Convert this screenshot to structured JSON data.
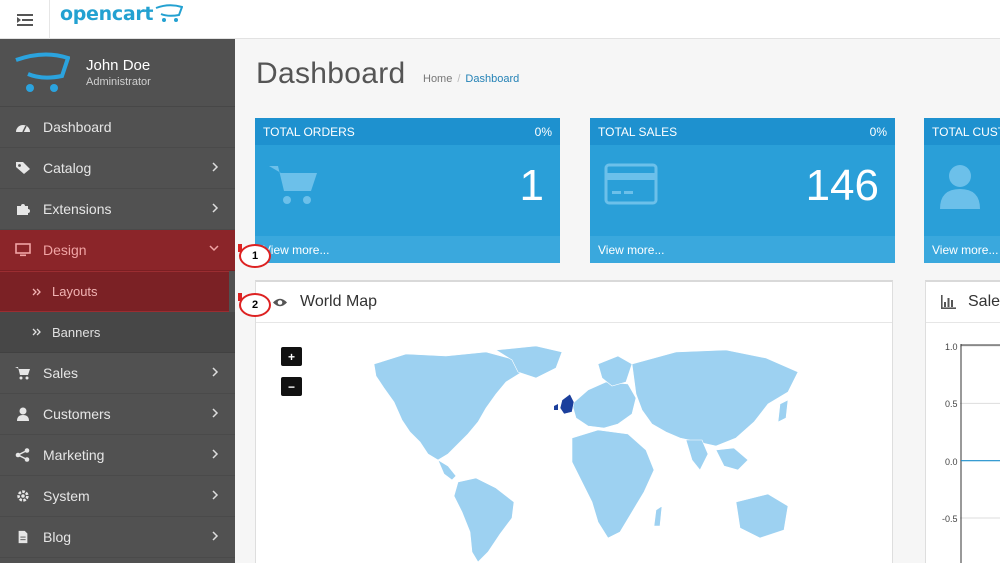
{
  "header": {
    "logo_text": "opencart"
  },
  "sidebar": {
    "profile": {
      "name": "John Doe",
      "role": "Administrator"
    },
    "items": [
      {
        "label": "Dashboard",
        "icon": "dashboard-icon"
      },
      {
        "label": "Catalog",
        "icon": "tags-icon"
      },
      {
        "label": "Extensions",
        "icon": "puzzle-icon"
      },
      {
        "label": "Design",
        "icon": "monitor-icon"
      },
      {
        "label": "Sales",
        "icon": "cart-icon"
      },
      {
        "label": "Customers",
        "icon": "user-icon"
      },
      {
        "label": "Marketing",
        "icon": "share-icon"
      },
      {
        "label": "System",
        "icon": "gear-icon"
      },
      {
        "label": "Blog",
        "icon": "document-icon"
      }
    ],
    "design_sub": [
      {
        "label": "Layouts"
      },
      {
        "label": "Banners"
      }
    ]
  },
  "page": {
    "title": "Dashboard",
    "breadcrumb": {
      "home": "Home",
      "separator": "/",
      "current": "Dashboard"
    }
  },
  "tiles": [
    {
      "title": "TOTAL ORDERS",
      "percent": "0%",
      "value": "1",
      "link": "View more...",
      "icon": "cart-icon"
    },
    {
      "title": "TOTAL SALES",
      "percent": "0%",
      "value": "146",
      "link": "View more...",
      "icon": "credit-card-icon"
    },
    {
      "title": "TOTAL CUST",
      "percent": "",
      "value": "",
      "link": "View more...",
      "icon": "user-icon"
    }
  ],
  "world_map": {
    "title": "World Map",
    "zoom_in": "+",
    "zoom_out": "−",
    "highlight_color": "#1b3f9c",
    "land_color": "#9dd1f1"
  },
  "sales_panel": {
    "title": "Sale"
  },
  "chart_data": {
    "type": "line",
    "title": "",
    "xlabel": "",
    "ylabel": "",
    "ylim": [
      -0.5,
      1.0
    ],
    "y_ticks": [
      "1.0",
      "0.5",
      "0.0",
      "-0.5"
    ],
    "series": [
      {
        "values": [
          0,
          0
        ]
      }
    ]
  },
  "annotations": [
    {
      "label": "1"
    },
    {
      "label": "2"
    }
  ],
  "colors": {
    "accent": "#2a9fd8",
    "sidebar_bg": "#515151",
    "active_red": "#8b2529"
  }
}
